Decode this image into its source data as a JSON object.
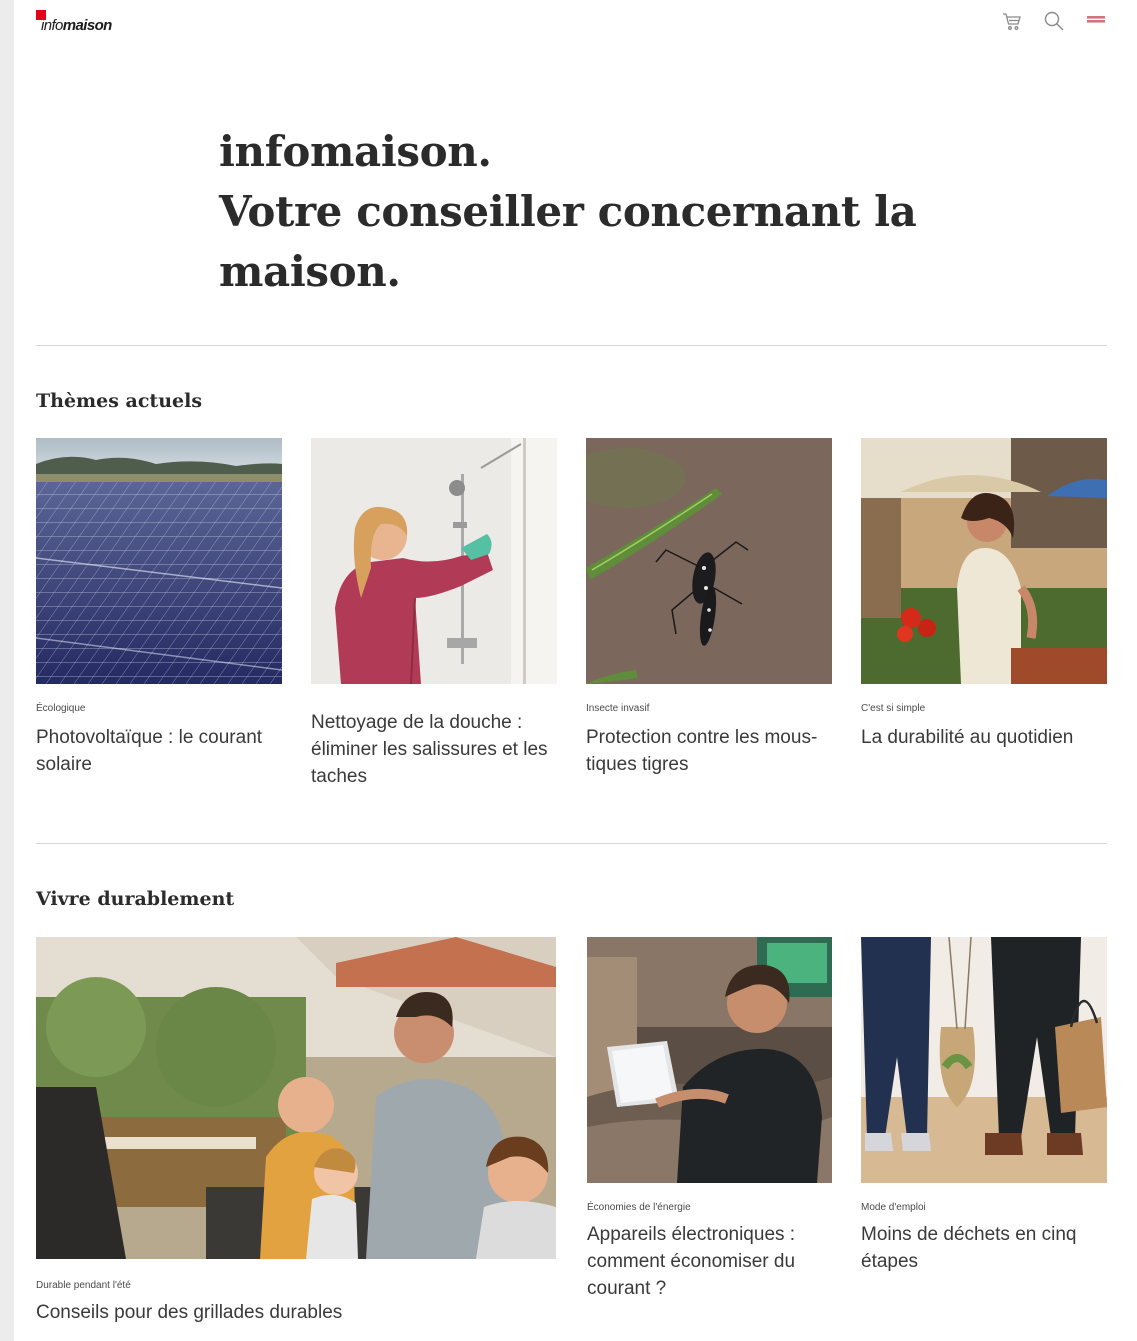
{
  "header": {
    "logo_light": "info",
    "logo_bold": "maison",
    "icons": [
      "cart-icon",
      "search-icon",
      "menu-icon"
    ],
    "accent": "#e2001a"
  },
  "hero": {
    "line1": "infomaison.",
    "line2": "Votre conseiller concernant la",
    "line3": "maison."
  },
  "themes": {
    "title": "Thèmes actuels",
    "cards": [
      {
        "category": "Écologique",
        "title": "Photovoltaïque : le courant solaire"
      },
      {
        "category": "",
        "title": "Nettoyage de la douche : éliminer les salissures et les taches"
      },
      {
        "category": "Insecte invasif",
        "title": "Protection contre les mous­tiques tigres"
      },
      {
        "category": "C'est si simple",
        "title": "La durabilité au quotidien"
      }
    ]
  },
  "durable": {
    "title": "Vivre durablement",
    "cards": [
      {
        "category": "Durable pendant l'été",
        "title": "Conseils pour des grillades durables"
      },
      {
        "category": "Économies de l'énergie",
        "title": "Appareils électroniques : comment économiser du courant ?"
      },
      {
        "category": "Mode d'emploi",
        "title": "Moins de déchets en cinq étapes"
      }
    ]
  }
}
